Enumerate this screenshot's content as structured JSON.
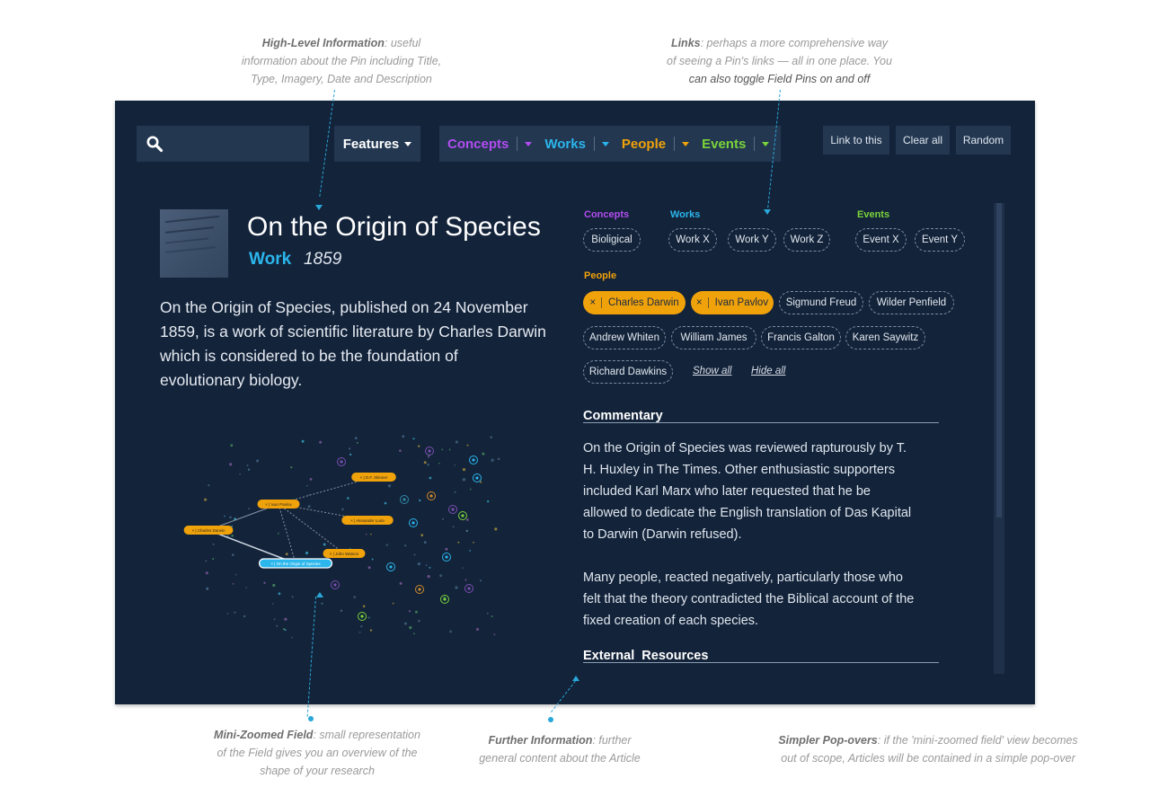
{
  "annotations": {
    "high_level": {
      "bold": "High-Level Information",
      "text_1": ": useful",
      "text_2": "information about the Pin including Title,",
      "text_3": "Type, Imagery, Date and Description"
    },
    "links": {
      "bold": "Links",
      "text_1": ": perhaps a more comprehensive way",
      "text_2": "of seeing a Pin's links — all in one place. You",
      "text_3": "can also toggle Field Pins on and off"
    },
    "mini_field": {
      "bold": "Mini-Zoomed Field",
      "text_1": ": small representation",
      "text_2": "of the Field gives you an overview of the",
      "text_3": "shape of your research"
    },
    "further": {
      "bold": "Further Information",
      "text_1": ": further",
      "text_2": "general content about the Article"
    },
    "popovers": {
      "bold": "Simpler Pop-overs",
      "text_1": ": if the 'mini-zoomed field' view becomes",
      "text_2": "out of scope, Articles will be contained in a simple pop-over"
    }
  },
  "toolbar": {
    "search_icon": "search-icon",
    "features_label": "Features",
    "filters": [
      {
        "label": "Concepts",
        "color": "#b24cf0"
      },
      {
        "label": "Works",
        "color": "#2bb6ec"
      },
      {
        "label": "People",
        "color": "#f0a20a"
      },
      {
        "label": "Events",
        "color": "#7ad33a"
      }
    ],
    "link_to_this": "Link to this",
    "clear_all": "Clear all",
    "random": "Random"
  },
  "pin": {
    "title": "On the Origin of Species",
    "type": "Work",
    "year": "1859",
    "description": "On the Origin of Species, published on 24 November 1859, is a work of scientific literature by Charles Darwin which is considered to be the foundation of evolutionary biology."
  },
  "links": {
    "concepts": {
      "label": "Concepts",
      "items": [
        "Bioligical"
      ]
    },
    "works": {
      "label": "Works",
      "items": [
        "Work X",
        "Work Y",
        "Work Z"
      ]
    },
    "events": {
      "label": "Events",
      "items": [
        "Event X",
        "Event Y"
      ]
    },
    "people": {
      "label": "People",
      "active_x": "×",
      "items": [
        "Charles Darwin",
        "Ivan Pavlov",
        "Sigmund Freud",
        "Wilder Penfield",
        "Andrew Whiten",
        "William James",
        "Francis Galton",
        "Karen Saywitz",
        "Richard Dawkins"
      ],
      "show_all": "Show all",
      "hide_all": "Hide all"
    }
  },
  "commentary": {
    "heading": "Commentary",
    "para_1": "On the Origin of Species was reviewed rapturously by T. H. Huxley in The Times. Other enthusiastic supporters included Karl Marx who later requested that he be allowed to dedicate the English translation of Das Kapital to Darwin (Darwin refused).",
    "para_2": "Many people, reacted negatively, particularly those who felt that the theory contradicted the Biblical account of the fixed creation of each species."
  },
  "external": {
    "heading": "External  Resources"
  },
  "mini_field": {
    "nodes": [
      "Charles Darwin",
      "Ivan Pavlov",
      "D.F. Skinner",
      "Alexander Luria",
      "John Watson",
      "On the Origin of Species"
    ]
  }
}
